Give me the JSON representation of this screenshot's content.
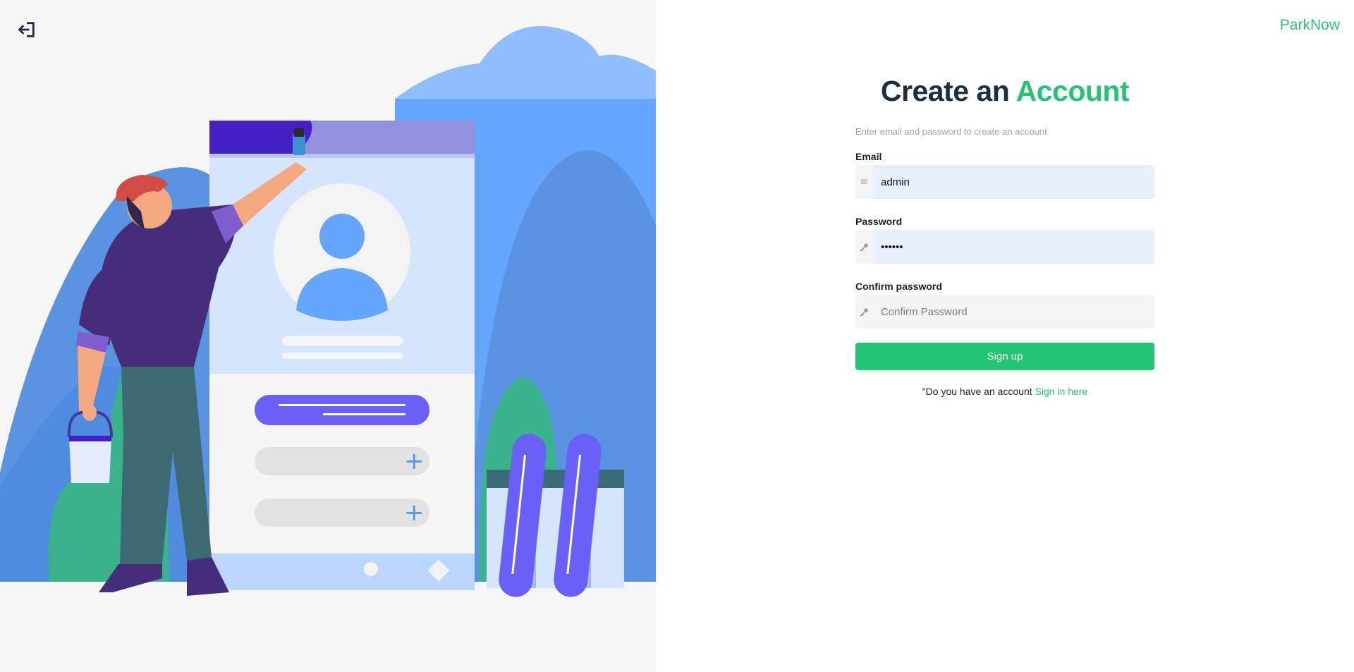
{
  "brand": "ParkNow",
  "form": {
    "title_part1": "Create an",
    "title_part2": "Account",
    "subtitle": "Enter email and password to create an account",
    "email_label": "Email",
    "email_value": "admin",
    "password_label": "Password",
    "password_value": "••••••",
    "confirm_label": "Confirm password",
    "confirm_placeholder": "Confirm Password",
    "signup_label": "Sign up",
    "account_prompt": "\"Do you have an account",
    "signin_link": "Sign in here"
  },
  "icons": {
    "back": "log-in-arrow-icon",
    "email": "envelope-icon",
    "password": "key-icon",
    "confirm": "key-icon"
  },
  "colors": {
    "accent": "#23c475",
    "title": "#1c2e44",
    "autofill": "#e8f0fe"
  }
}
